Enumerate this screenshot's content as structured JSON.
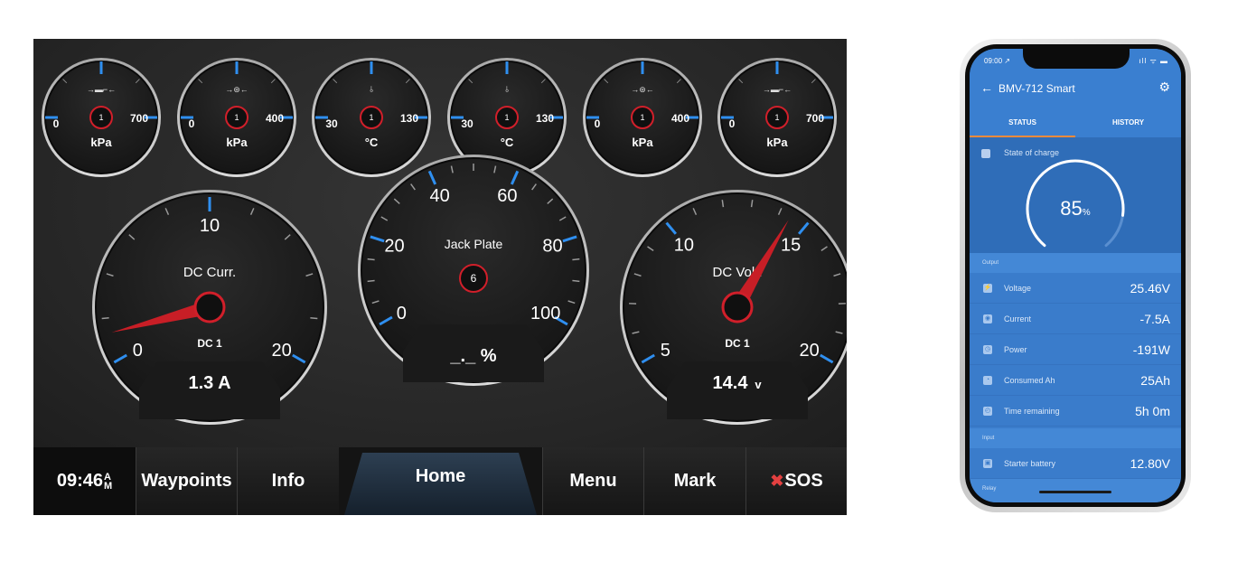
{
  "mfd": {
    "small_gauges": [
      {
        "icon": "oil-pressure-icon",
        "icon_text": "→▬⌐←",
        "min": "0",
        "max": "700",
        "unit": "kPa",
        "badge": "1"
      },
      {
        "icon": "transmission-pressure-icon",
        "icon_text": "→⊛←",
        "min": "0",
        "max": "400",
        "unit": "kPa",
        "badge": "1"
      },
      {
        "icon": "coolant-temp-icon",
        "icon_text": "⫰",
        "min": "30",
        "max": "130",
        "unit": "°C",
        "badge": "1"
      },
      {
        "icon": "coolant-temp-icon",
        "icon_text": "⫰",
        "min": "30",
        "max": "130",
        "unit": "°C",
        "badge": "1"
      },
      {
        "icon": "transmission-pressure-icon",
        "icon_text": "→⊛←",
        "min": "0",
        "max": "400",
        "unit": "kPa",
        "badge": "1"
      },
      {
        "icon": "oil-pressure-icon",
        "icon_text": "→▬⌐←",
        "min": "0",
        "max": "700",
        "unit": "kPa",
        "badge": "1"
      }
    ],
    "dc_current": {
      "title": "DC Curr.",
      "source": "DC 1",
      "scale_labels": [
        "0",
        "10",
        "20"
      ],
      "readout": "1.3 A",
      "value": 1.3,
      "range": [
        0,
        20
      ]
    },
    "jack_plate": {
      "title": "Jack Plate",
      "badge": "6",
      "scale_labels": [
        "0",
        "20",
        "40",
        "60",
        "80",
        "100"
      ],
      "readout": "_._ %"
    },
    "dc_volt": {
      "title": "DC Volt.",
      "source": "DC 1",
      "scale_labels": [
        "5",
        "10",
        "15",
        "20"
      ],
      "readout": "14.4",
      "readout_unit": "v",
      "value": 14.4,
      "range": [
        5,
        20
      ]
    },
    "nav": {
      "time": "09:46",
      "ampm_top": "A",
      "ampm_bottom": "M",
      "waypoints": "Waypoints",
      "info": "Info",
      "home": "Home",
      "menu": "Menu",
      "mark": "Mark",
      "sos_icon": "✖",
      "sos": "SOS"
    },
    "colors": {
      "accent_blue": "#2f8ff0",
      "badge_red": "#d11f2a",
      "needle_red": "#c81e26"
    }
  },
  "phone": {
    "status_time": "09:00 ↗",
    "status_icons": "ıll ᯤ ▬",
    "back_icon": "←",
    "title": "BMV-712 Smart",
    "gear_icon": "⚙",
    "tabs": {
      "status": "STATUS",
      "history": "HISTORY"
    },
    "soc": {
      "label": "State of charge",
      "value": "85",
      "unit": "%",
      "level": 0.85
    },
    "sections": {
      "output": "Output",
      "input": "Input",
      "relay": "Relay"
    },
    "output_rows": [
      {
        "icon": "⚡",
        "label": "Voltage",
        "value": "25.46V"
      },
      {
        "icon": "◉",
        "label": "Current",
        "value": "-7.5A"
      },
      {
        "icon": "◷",
        "label": "Power",
        "value": "-191W"
      },
      {
        "icon": "◔",
        "label": "Consumed Ah",
        "value": "25Ah"
      },
      {
        "icon": "◴",
        "label": "Time remaining",
        "value": "5h 0m"
      }
    ],
    "input_rows": [
      {
        "icon": "▣",
        "label": "Starter battery",
        "value": "12.80V"
      }
    ],
    "colors": {
      "app_blue": "#3a7fd0",
      "tab_indicator": "#f08a3c"
    }
  }
}
